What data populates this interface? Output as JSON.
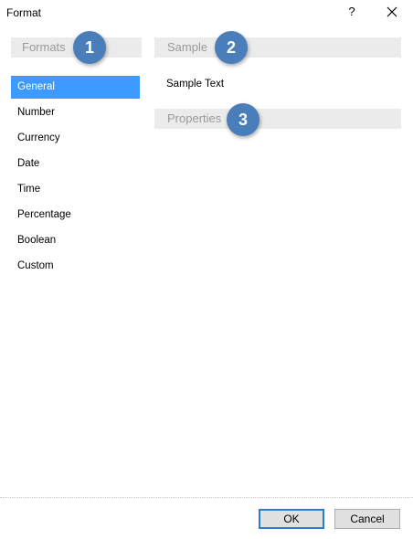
{
  "window": {
    "title": "Format",
    "help_glyph": "?",
    "close_icon": "close-icon"
  },
  "sections": {
    "formats": "Formats",
    "sample": "Sample",
    "properties": "Properties"
  },
  "badges": [
    "1",
    "2",
    "3"
  ],
  "formats_list": {
    "selected": "General",
    "items": [
      "General",
      "Number",
      "Currency",
      "Date",
      "Time",
      "Percentage",
      "Boolean",
      "Custom"
    ]
  },
  "sample": {
    "text": "Sample Text"
  },
  "buttons": {
    "ok": "OK",
    "cancel": "Cancel"
  },
  "colors": {
    "selection": "#3d9aff",
    "badge": "#4a7eba",
    "header_bg": "#ebebeb",
    "ok_border": "#2b7cd4"
  }
}
